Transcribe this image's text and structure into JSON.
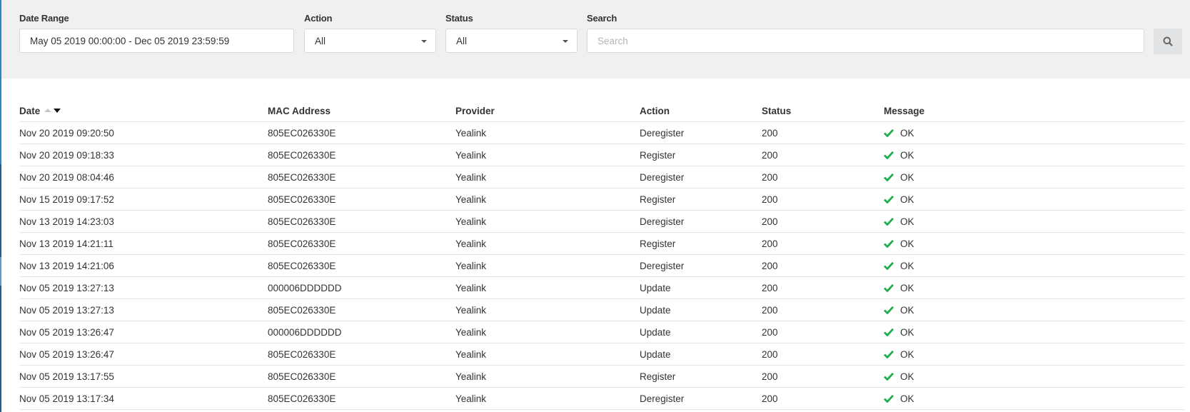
{
  "filters": {
    "date_range": {
      "label": "Date Range",
      "value": "May 05 2019 00:00:00 - Dec 05 2019 23:59:59"
    },
    "action": {
      "label": "Action",
      "selected": "All"
    },
    "status": {
      "label": "Status",
      "selected": "All"
    },
    "search": {
      "label": "Search",
      "value": "",
      "placeholder": "Search",
      "button_icon": "search-icon"
    }
  },
  "table": {
    "columns": {
      "date": "Date",
      "mac": "MAC Address",
      "provider": "Provider",
      "action": "Action",
      "status": "Status",
      "message": "Message"
    },
    "sort": {
      "column": "Date",
      "direction": "descending"
    },
    "colors": {
      "ok_check": "#1fae4b"
    },
    "rows": [
      {
        "date": "Nov 20 2019 09:20:50",
        "mac": "805EC026330E",
        "provider": "Yealink",
        "action": "Deregister",
        "status": "200",
        "message": "OK",
        "message_icon": "check-icon"
      },
      {
        "date": "Nov 20 2019 09:18:33",
        "mac": "805EC026330E",
        "provider": "Yealink",
        "action": "Register",
        "status": "200",
        "message": "OK",
        "message_icon": "check-icon"
      },
      {
        "date": "Nov 20 2019 08:04:46",
        "mac": "805EC026330E",
        "provider": "Yealink",
        "action": "Deregister",
        "status": "200",
        "message": "OK",
        "message_icon": "check-icon"
      },
      {
        "date": "Nov 15 2019 09:17:52",
        "mac": "805EC026330E",
        "provider": "Yealink",
        "action": "Register",
        "status": "200",
        "message": "OK",
        "message_icon": "check-icon"
      },
      {
        "date": "Nov 13 2019 14:23:03",
        "mac": "805EC026330E",
        "provider": "Yealink",
        "action": "Deregister",
        "status": "200",
        "message": "OK",
        "message_icon": "check-icon"
      },
      {
        "date": "Nov 13 2019 14:21:11",
        "mac": "805EC026330E",
        "provider": "Yealink",
        "action": "Register",
        "status": "200",
        "message": "OK",
        "message_icon": "check-icon"
      },
      {
        "date": "Nov 13 2019 14:21:06",
        "mac": "805EC026330E",
        "provider": "Yealink",
        "action": "Deregister",
        "status": "200",
        "message": "OK",
        "message_icon": "check-icon"
      },
      {
        "date": "Nov 05 2019 13:27:13",
        "mac": "000006DDDDDD",
        "provider": "Yealink",
        "action": "Update",
        "status": "200",
        "message": "OK",
        "message_icon": "check-icon"
      },
      {
        "date": "Nov 05 2019 13:27:13",
        "mac": "805EC026330E",
        "provider": "Yealink",
        "action": "Update",
        "status": "200",
        "message": "OK",
        "message_icon": "check-icon"
      },
      {
        "date": "Nov 05 2019 13:26:47",
        "mac": "000006DDDDDD",
        "provider": "Yealink",
        "action": "Update",
        "status": "200",
        "message": "OK",
        "message_icon": "check-icon"
      },
      {
        "date": "Nov 05 2019 13:26:47",
        "mac": "805EC026330E",
        "provider": "Yealink",
        "action": "Update",
        "status": "200",
        "message": "OK",
        "message_icon": "check-icon"
      },
      {
        "date": "Nov 05 2019 13:17:55",
        "mac": "805EC026330E",
        "provider": "Yealink",
        "action": "Register",
        "status": "200",
        "message": "OK",
        "message_icon": "check-icon"
      },
      {
        "date": "Nov 05 2019 13:17:34",
        "mac": "805EC026330E",
        "provider": "Yealink",
        "action": "Deregister",
        "status": "200",
        "message": "OK",
        "message_icon": "check-icon"
      }
    ]
  }
}
